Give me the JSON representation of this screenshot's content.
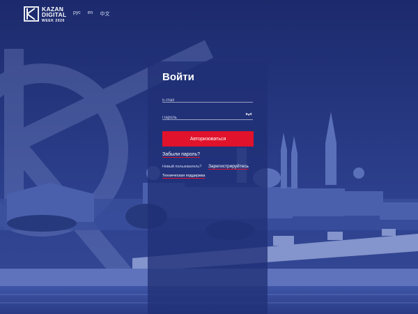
{
  "header": {
    "logo": {
      "line1": "KAZAN",
      "line2": "DIGITAL",
      "line3": "WEEK 2020"
    },
    "languages": [
      "рус",
      "en",
      "中文"
    ]
  },
  "login": {
    "title": "Войти",
    "email_placeholder": "E-mail",
    "password_placeholder": "Пароль",
    "submit_label": "Авторизоваться",
    "forgot_label": "Забыли пароль?",
    "new_user_label": "Новый пользователь?",
    "register_label": "Зарегистрируйтесь",
    "support_label": "Техническая поддержка"
  },
  "colors": {
    "accent": "#e1122b",
    "overlay": "#1f2f73",
    "panel": "#203076"
  },
  "icons": [
    "logo-mark-icon",
    "eye-toggle-icon"
  ]
}
